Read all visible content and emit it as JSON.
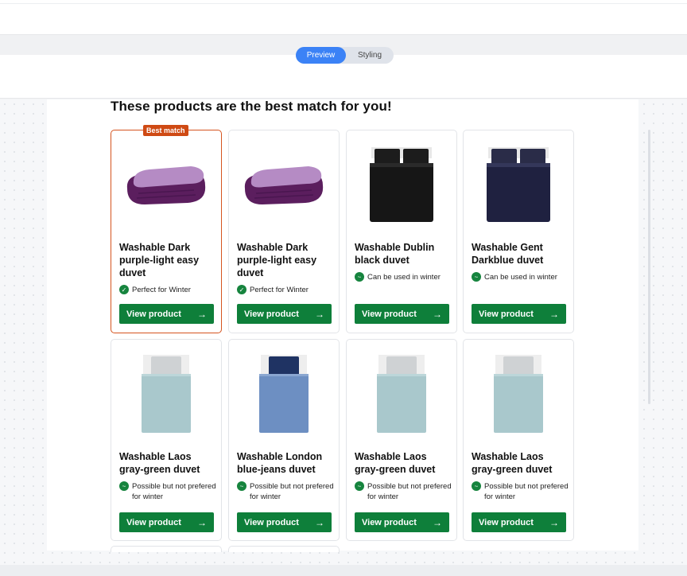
{
  "toggle": {
    "preview": "Preview",
    "styling": "Styling"
  },
  "heading": "These products are the best match for you!",
  "badge": "Best match",
  "button_label": "View product",
  "button_arrow": "→",
  "products": [
    {
      "title": "Washable Dark purple-light easy duvet",
      "feature": "Perfect for Winter",
      "feature_icon": "check-circle-icon",
      "image": "purple-comforter"
    },
    {
      "title": "Washable Dark purple-light easy duvet",
      "feature": "Perfect for Winter",
      "feature_icon": "check-circle-icon",
      "image": "purple-comforter"
    },
    {
      "title": "Washable Dublin black duvet",
      "feature": "Can be used in winter",
      "feature_icon": "wave-circle-icon",
      "image": "black-double-bed"
    },
    {
      "title": "Washable Gent Darkblue duvet",
      "feature": "Can be used in winter",
      "feature_icon": "wave-circle-icon",
      "image": "darkblue-double-bed"
    },
    {
      "title": "Washable Laos gray-green duvet",
      "feature": "Possible but not prefered for winter",
      "feature_icon": "wave-circle-icon",
      "image": "graygreen-single-bed"
    },
    {
      "title": "Washable London blue-jeans duvet",
      "feature": "Possible but not prefered for winter",
      "feature_icon": "wave-circle-icon",
      "image": "bluejeans-single-bed"
    },
    {
      "title": "Washable Laos gray-green duvet",
      "feature": "Possible but not prefered for winter",
      "feature_icon": "wave-circle-icon",
      "image": "graygreen-single-bed"
    },
    {
      "title": "Washable Laos gray-green duvet",
      "feature": "Possible but not prefered for winter",
      "feature_icon": "wave-circle-icon",
      "image": "graygreen-single-bed"
    }
  ],
  "colors": {
    "accent_blue": "#3b82f6",
    "button_green": "#0e7f3a",
    "best_match_orange": "#cf4a14"
  }
}
